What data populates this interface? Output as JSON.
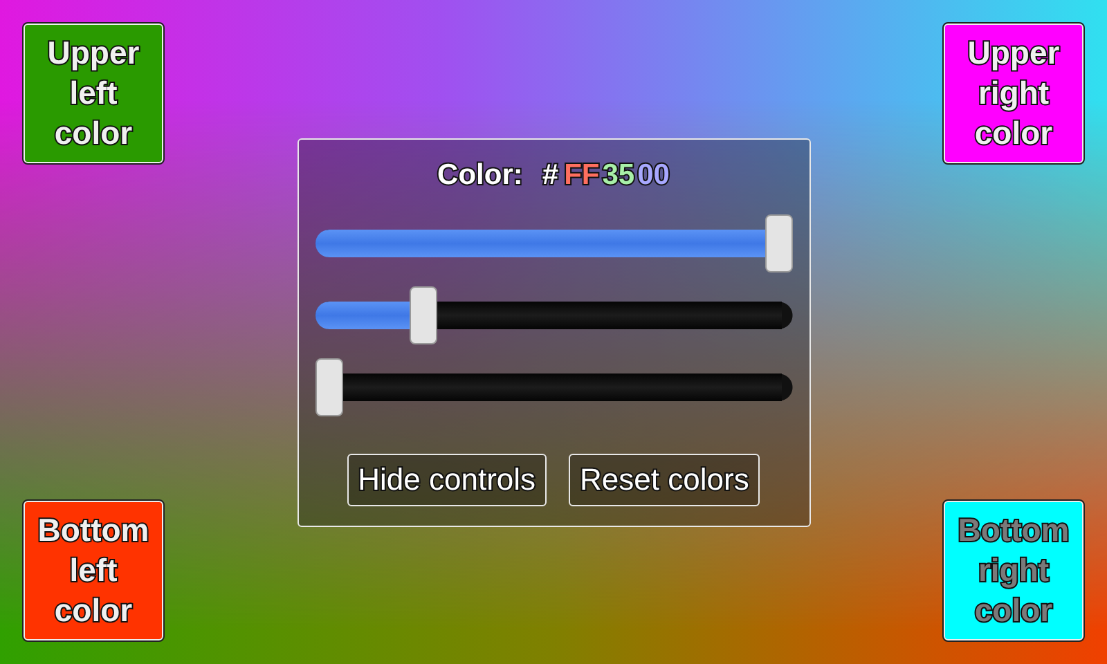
{
  "swatches": [
    {
      "label": "Upper left color",
      "color": "#2a9a00"
    },
    {
      "label": "Upper right color",
      "color": "#ff00ff"
    },
    {
      "label": "Bottom left color",
      "color": "#ff3300"
    },
    {
      "label": "Bottom right color",
      "color": "#00ffff"
    }
  ],
  "panel": {
    "title": {
      "label": "Color:",
      "hash": "#",
      "components": [
        {
          "text": "FF",
          "color": "#ff6f5f"
        },
        {
          "text": "35",
          "color": "#a8f0a8"
        },
        {
          "text": "00",
          "color": "#a8a8ff"
        }
      ]
    },
    "sliders": [
      {
        "level": 1
      },
      {
        "level": 0.21
      },
      {
        "level": 0
      }
    ],
    "buttons": [
      "Hide controls",
      "Reset colors"
    ]
  }
}
